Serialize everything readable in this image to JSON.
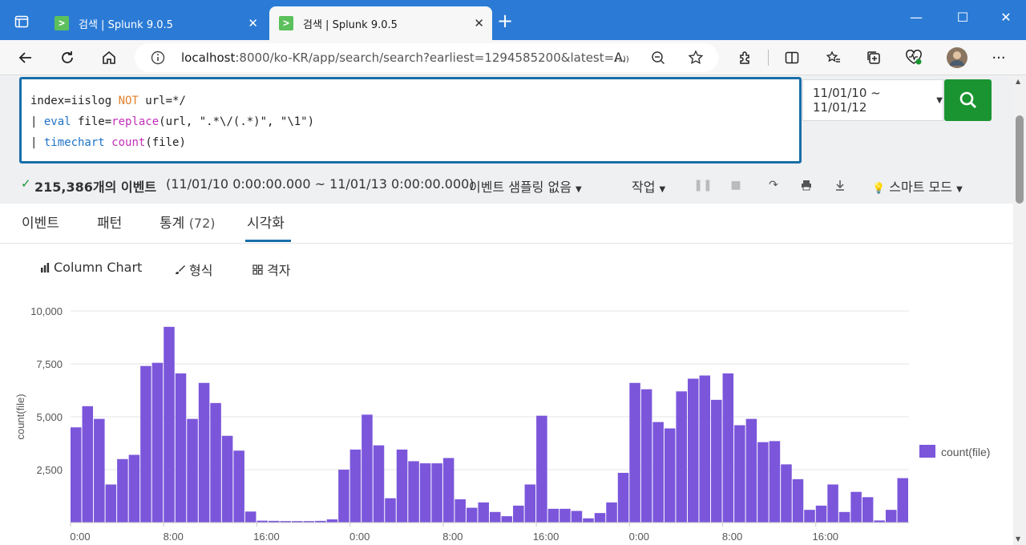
{
  "browser": {
    "tabs": [
      {
        "title": "검색 | Splunk 9.0.5",
        "active": false
      },
      {
        "title": "검색 | Splunk 9.0.5",
        "active": true
      }
    ],
    "new_tab": "+",
    "url_host": "localhost",
    "url_rest": ":8000/ko-KR/app/search/search?earliest=1294585200&latest=..."
  },
  "search": {
    "query_line1_a": "index=iislog ",
    "query_line1_not": "NOT",
    "query_line1_b": " url=*/",
    "query_line2_pipe": "| ",
    "query_line2_eval": "eval",
    "query_line2_mid": " file=",
    "query_line2_replace": "replace",
    "query_line2_args": "(url, \".*\\/(.*)\", \"\\1\")",
    "query_line3_pipe": "| ",
    "query_line3_timechart": "timechart",
    "query_line3_space": " ",
    "query_line3_count": "count",
    "query_line3_args": "(file)",
    "time_range": "11/01/10 ~ 11/01/12"
  },
  "status": {
    "check": "✓",
    "event_count": "215,386개의 이벤트",
    "event_range": "(11/01/10 0:00:00.000 ~ 11/01/13 0:00:00.000)",
    "sampling": "이벤트 샘플링 없음",
    "job": "작업",
    "smart_mode": "스마트 모드"
  },
  "result_tabs": {
    "events": "이벤트",
    "patterns": "패턴",
    "stats": "통계",
    "stats_count": "(72)",
    "viz": "시각화"
  },
  "viz_toolbar": {
    "chart_type": "Column Chart",
    "format": "형식",
    "trellis": "격자"
  },
  "colors": {
    "bar": "#7b56db",
    "search_green": "#1a9431",
    "accent_blue": "#1a6ea8"
  },
  "chart_data": {
    "type": "bar",
    "title": "",
    "xlabel": "",
    "ylabel": "count(file)",
    "ylim": [
      0,
      10000
    ],
    "y_ticks": [
      "10,000",
      "7,500",
      "5,000",
      "2,500"
    ],
    "x_tick_labels": [
      {
        "index": 0,
        "label": "0:00"
      },
      {
        "index": 8,
        "label": "8:00"
      },
      {
        "index": 16,
        "label": "16:00"
      },
      {
        "index": 24,
        "label": "0:00"
      },
      {
        "index": 32,
        "label": "8:00"
      },
      {
        "index": 40,
        "label": "16:00"
      },
      {
        "index": 48,
        "label": "0:00"
      },
      {
        "index": 56,
        "label": "8:00"
      },
      {
        "index": 64,
        "label": "16:00"
      }
    ],
    "series": [
      {
        "name": "count(file)",
        "values": [
          4500,
          5500,
          4900,
          1800,
          3000,
          3200,
          7400,
          7550,
          9250,
          7050,
          4900,
          6600,
          5650,
          4100,
          3400,
          520,
          90,
          80,
          70,
          70,
          70,
          80,
          150,
          2500,
          3450,
          5100,
          3650,
          1150,
          3450,
          2900,
          2800,
          2800,
          3050,
          1100,
          700,
          950,
          500,
          300,
          800,
          1800,
          5050,
          650,
          650,
          550,
          200,
          450,
          950,
          2350,
          6600,
          6300,
          4750,
          4450,
          6200,
          6800,
          6950,
          5800,
          7050,
          4600,
          4900,
          3800,
          3850,
          2750,
          2050,
          600,
          800,
          1800,
          500,
          1450,
          1200,
          100,
          600,
          2100
        ]
      }
    ],
    "legend": "right"
  }
}
